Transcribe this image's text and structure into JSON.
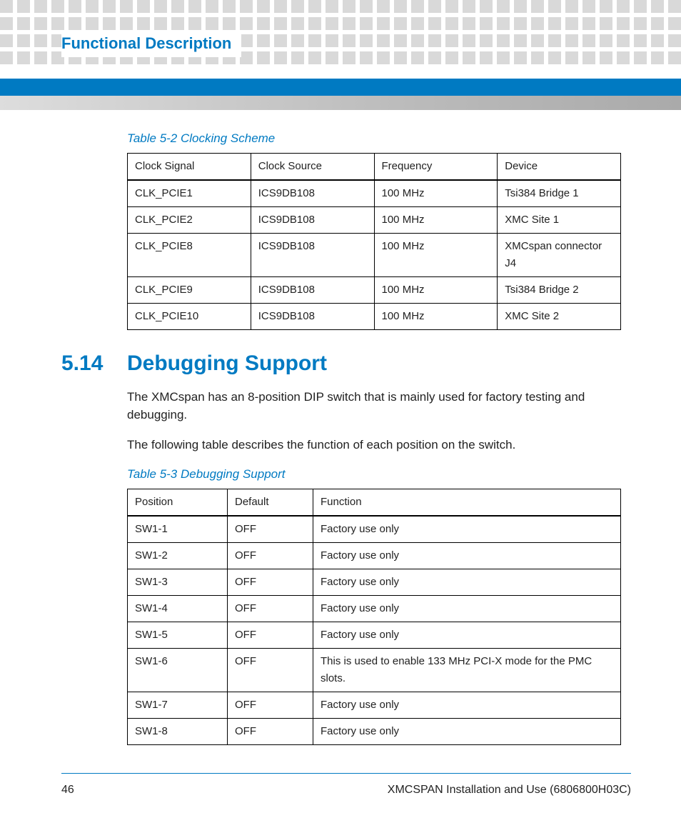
{
  "header": {
    "section_title": "Functional Description"
  },
  "table1": {
    "caption": "Table 5-2 Clocking Scheme",
    "headers": [
      "Clock Signal",
      "Clock Source",
      "Frequency",
      "Device"
    ],
    "rows": [
      [
        "CLK_PCIE1",
        "ICS9DB108",
        "100 MHz",
        "Tsi384 Bridge 1"
      ],
      [
        "CLK_PCIE2",
        "ICS9DB108",
        "100 MHz",
        "XMC Site 1"
      ],
      [
        "CLK_PCIE8",
        "ICS9DB108",
        "100 MHz",
        "XMCspan connector J4"
      ],
      [
        "CLK_PCIE9",
        "ICS9DB108",
        "100 MHz",
        "Tsi384 Bridge 2"
      ],
      [
        "CLK_PCIE10",
        "ICS9DB108",
        "100 MHz",
        "XMC Site 2"
      ]
    ]
  },
  "section": {
    "number": "5.14",
    "title": "Debugging Support",
    "para1": "The XMCspan has an 8-position DIP switch that is mainly used for factory testing and debugging.",
    "para2": "The following table describes the function of each position on the switch."
  },
  "table2": {
    "caption": "Table 5-3 Debugging Support",
    "headers": [
      "Position",
      "Default",
      "Function"
    ],
    "rows": [
      [
        "SW1-1",
        "OFF",
        "Factory use only"
      ],
      [
        "SW1-2",
        "OFF",
        "Factory use only"
      ],
      [
        "SW1-3",
        "OFF",
        "Factory use only"
      ],
      [
        "SW1-4",
        "OFF",
        "Factory use only"
      ],
      [
        "SW1-5",
        "OFF",
        "Factory use only"
      ],
      [
        "SW1-6",
        "OFF",
        "This is used to enable 133 MHz PCI-X mode for the PMC slots."
      ],
      [
        "SW1-7",
        "OFF",
        "Factory use only"
      ],
      [
        "SW1-8",
        "OFF",
        "Factory use only"
      ]
    ]
  },
  "footer": {
    "page": "46",
    "doc": "XMCSPAN Installation and Use (6806800H03C)"
  }
}
